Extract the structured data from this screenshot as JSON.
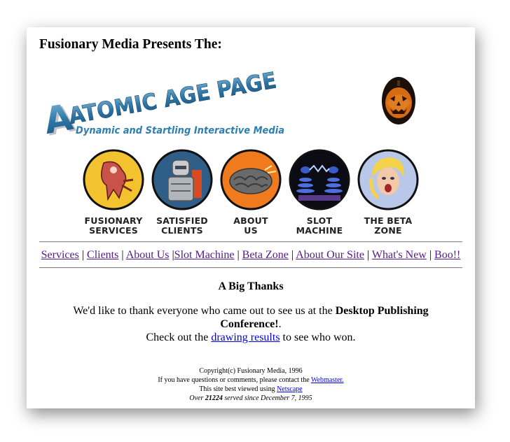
{
  "header": {
    "presents": "Fusionary Media Presents The:"
  },
  "logo": {
    "title": "ATOMIC AGE PAGE",
    "tagline": "Dynamic and Startling Interactive Media"
  },
  "icons": [
    {
      "caption": "FUSIONARY\nSERVICES",
      "icon": "alien-creature-icon"
    },
    {
      "caption": "SATISFIED\nCLIENTS",
      "icon": "robot-icon"
    },
    {
      "caption": "ABOUT\nUS",
      "icon": "brain-icon"
    },
    {
      "caption": "SLOT\nMACHINE",
      "icon": "tesla-coil-icon"
    },
    {
      "caption": "THE BETA\nZONE",
      "icon": "screaming-woman-icon"
    }
  ],
  "nav": {
    "links": [
      "Services",
      "Clients",
      "About Us",
      "Slot Machine",
      "Beta Zone",
      "About Our Site",
      "What's New",
      "Boo!!"
    ],
    "separator": "|"
  },
  "main": {
    "heading": "A Big Thanks",
    "line1_pre": "We'd like to thank everyone who came out to see us at the ",
    "line1_bold": "Desktop Publishing Conference!",
    "line1_post": ".",
    "line2_pre": "Check out the ",
    "line2_link": "drawing results",
    "line2_post": " to see who won."
  },
  "footer": {
    "copyright": "Copyright(c) Fusionary Media, 1996",
    "contact_pre": "If you have questions or comments, please contact the ",
    "contact_link": "Webmaster.",
    "viewed_pre": "This site best viewed using ",
    "viewed_link": "Netscape",
    "served_pre": "Over ",
    "served_count": "21224",
    "served_post": " served since December 7, 1995"
  },
  "colors": {
    "nav_link": "#551a8b",
    "link": "#0000ee",
    "logo_blue": "#2f86b5",
    "pumpkin_orange": "#d86b12"
  }
}
